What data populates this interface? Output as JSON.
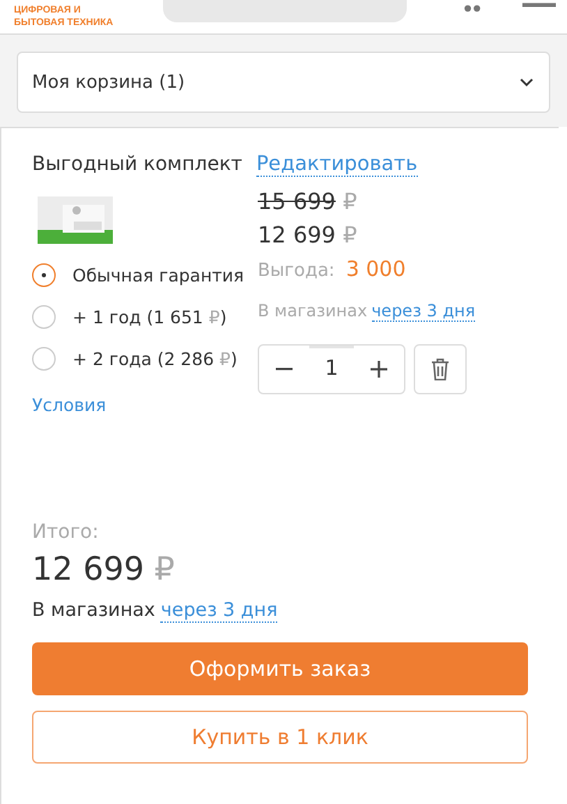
{
  "header": {
    "logo_lines": [
      "ЦИФРОВАЯ И",
      "БЫТОВАЯ ТЕХНИКА"
    ]
  },
  "cart_dropdown": {
    "label": "Моя корзина (1)",
    "expanded": false
  },
  "bundle": {
    "title": "Выгодный комплект",
    "edit_link": "Редактировать",
    "old_price": {
      "amount": "15 699",
      "currency": "₽"
    },
    "price": {
      "amount": "12 699",
      "currency": "₽"
    },
    "savings_label": "Выгода:",
    "savings": "3 000",
    "availability_label": "В магазинах",
    "availability_link": "через 3 дня",
    "warranty_options": [
      {
        "label": "Обычная гарантия",
        "selected": true
      },
      {
        "label": "+ 1 год (1 651",
        "currency": "₽",
        "suffix": ")",
        "selected": false
      },
      {
        "label": "+ 2 года (2 286",
        "currency": "₽",
        "suffix": ")",
        "selected": false
      }
    ],
    "conditions_link": "Условия",
    "quantity": "1"
  },
  "total": {
    "label": "Итого:",
    "amount": "12 699",
    "currency": "₽",
    "availability_label": "В магазинах",
    "availability_link": "через 3 дня"
  },
  "buttons": [
    {
      "label": "Оформить заказ",
      "kind": "primary"
    },
    {
      "label": "Купить в 1 клик",
      "kind": "secondary"
    }
  ]
}
